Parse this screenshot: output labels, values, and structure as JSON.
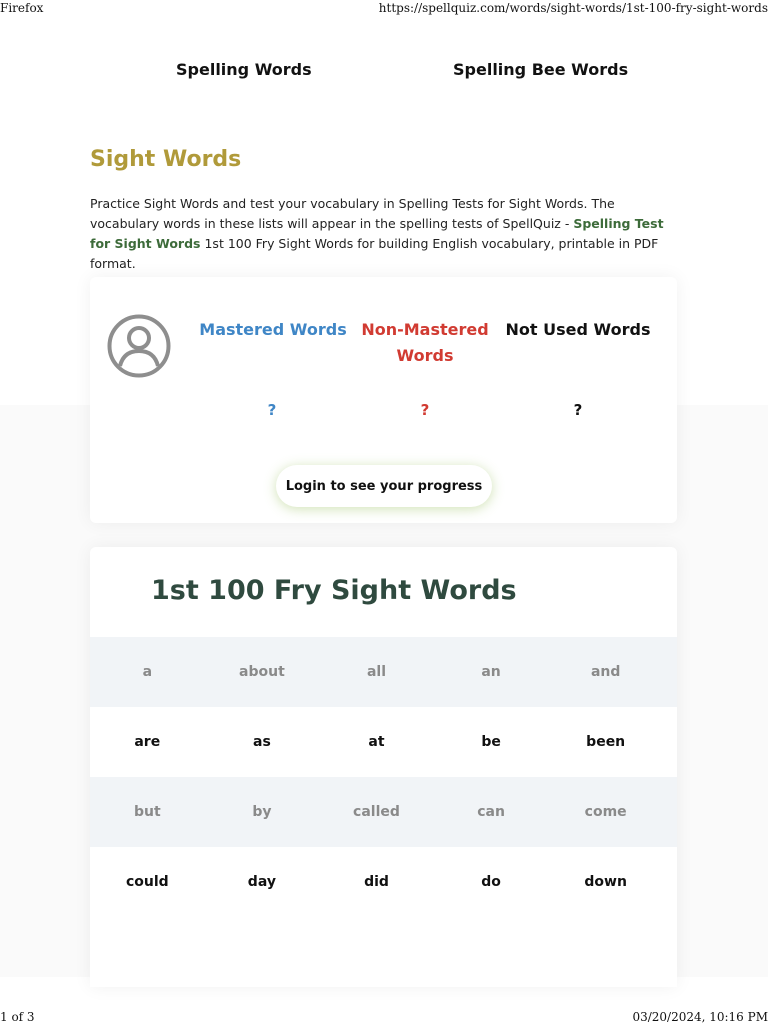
{
  "print": {
    "browser": "Firefox",
    "url": "https://spellquiz.com/words/sight-words/1st-100-fry-sight-words",
    "page_counter": "1 of 3",
    "datetime": "03/20/2024, 10:16 PM"
  },
  "nav": {
    "spelling_words": "Spelling Words",
    "spelling_bee_words": "Spelling Bee Words"
  },
  "section": {
    "title": "Sight Words",
    "intro_before": "Practice Sight Words and test your vocabulary in Spelling Tests for Sight Words. The vocabulary words in these lists will appear in the spelling tests of SpellQuiz - ",
    "intro_link": "Spelling Test for Sight Words",
    "intro_after": " 1st 100 Fry Sight Words for building English vocabulary, printable in PDF format."
  },
  "progress": {
    "avatar_icon": "user-circle-icon",
    "mastered_label": "Mastered Words",
    "nonmastered_label": "Non-Mastered Words",
    "notused_label": "Not Used Words",
    "mastered_value": "?",
    "nonmastered_value": "?",
    "notused_value": "?",
    "login_label": "Login to see your progress",
    "colors": {
      "mastered": "#3f86c6",
      "nonmastered": "#d13b32",
      "title": "#b09a3a"
    }
  },
  "word_list": {
    "title": "1st 100 Fry Sight Words",
    "rows": [
      [
        "a",
        "about",
        "all",
        "an",
        "and"
      ],
      [
        "are",
        "as",
        "at",
        "be",
        "been"
      ],
      [
        "but",
        "by",
        "called",
        "can",
        "come"
      ],
      [
        "could",
        "day",
        "did",
        "do",
        "down"
      ]
    ]
  }
}
